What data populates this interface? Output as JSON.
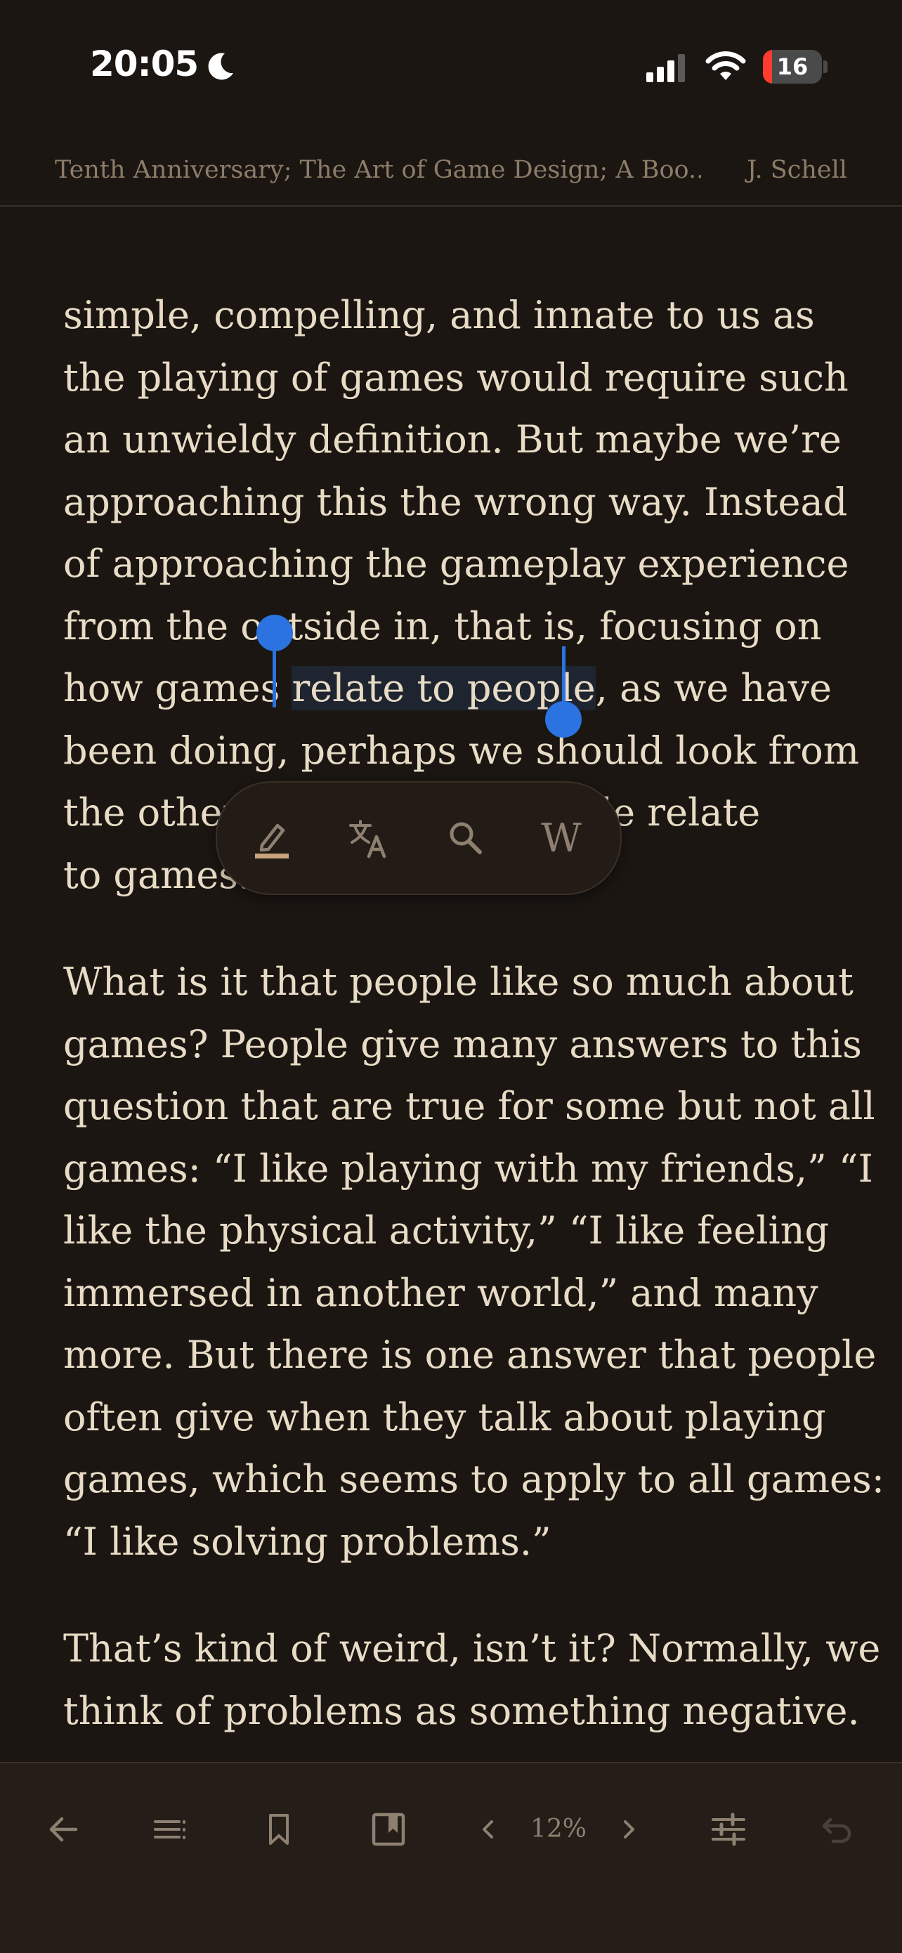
{
  "status_bar": {
    "time": "20:05",
    "battery_level": "16",
    "battery_fraction": 0.16
  },
  "book": {
    "title": "Tenth Anniversary; The Art of Game Design; A Boo...",
    "author": "J. Schell"
  },
  "content": {
    "paragraphs": [
      [
        "simple, compelling, and innate to us as",
        "the playing of games would require such",
        "an unwieldy definition. But maybe we’re",
        "approaching this the wrong way. Instead",
        "of approaching the gameplay experience",
        "from the outside in, that is, focusing on",
        {
          "before": "how games ",
          "selected": "relate to people",
          "after": ", as we have"
        },
        "been doing, perhaps we should look from",
        "the other side: how do people relate",
        "to games."
      ],
      [
        "What is it that people like so much about",
        "games? People give many answers to this",
        "question that are true for some but not all",
        "games: “I like playing with my friends,” “I",
        "like the physical activity,” “I like feeling",
        "immersed in another world,” and many",
        "more. But there is one answer that people",
        "often give when they talk about playing",
        "games, which seems to apply to all games:",
        "“I like solving problems.”"
      ],
      [
        "That’s kind of weird, isn’t it? Normally, we",
        "think of problems as something negative."
      ]
    ],
    "selected_text": "relate to people"
  },
  "selection_menu": {
    "items": [
      {
        "name": "highlight",
        "icon": "highlighter-icon"
      },
      {
        "name": "translate",
        "icon": "translate-icon"
      },
      {
        "name": "search",
        "icon": "search-icon"
      },
      {
        "name": "wikipedia",
        "icon": "wikipedia-icon",
        "glyph": "W"
      }
    ]
  },
  "toolbar": {
    "progress": "12%",
    "progress_fraction": 0.12,
    "items": [
      "back-arrow-icon",
      "table-of-contents-icon",
      "bookmark-icon",
      "bookmarks-list-icon",
      "previous-page-icon",
      "next-page-icon",
      "settings-sliders-icon",
      "undo-icon"
    ]
  },
  "colors": {
    "background": "#1b1612",
    "text": "#e8dcc6",
    "muted_text": "#8c7c68",
    "selection_accent": "#2a73e0",
    "highlight_underline": "#c9a27e",
    "toolbar_bg": "#241d18"
  }
}
